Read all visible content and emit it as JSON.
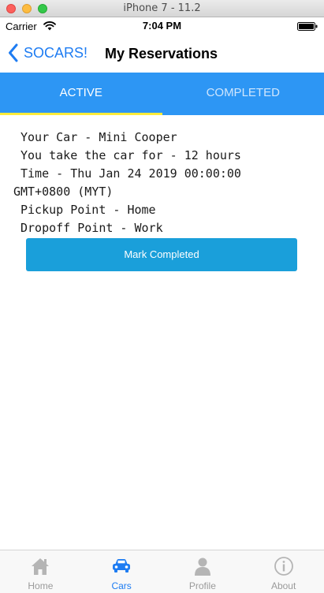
{
  "window": {
    "title": "iPhone 7 - 11.2"
  },
  "status_bar": {
    "carrier": "Carrier",
    "time": "7:04 PM"
  },
  "nav": {
    "back_label": "SOCARS!",
    "title": "My Reservations"
  },
  "tabs": [
    {
      "label": "ACTIVE",
      "active": true
    },
    {
      "label": "COMPLETED",
      "active": false
    }
  ],
  "reservation": {
    "lines": [
      "Your Car - Mini Cooper",
      "You take the car for - 12 hours",
      "Time - Thu Jan 24 2019 00:00:00",
      "GMT+0800 (MYT)",
      "Pickup Point - Home",
      "Dropoff Point - Work"
    ],
    "button_label": "Mark Completed"
  },
  "bottom_tabs": [
    {
      "label": "Home",
      "icon": "home-icon",
      "active": false
    },
    {
      "label": "Cars",
      "icon": "car-icon",
      "active": true
    },
    {
      "label": "Profile",
      "icon": "profile-icon",
      "active": false
    },
    {
      "label": "About",
      "icon": "info-icon",
      "active": false
    }
  ],
  "colors": {
    "accent": "#1e7cf2",
    "tab_bar": "#2d96f4",
    "tab_indicator": "#ffeb3b",
    "button": "#1a9fda",
    "inactive_icon": "#b5b5b5"
  }
}
